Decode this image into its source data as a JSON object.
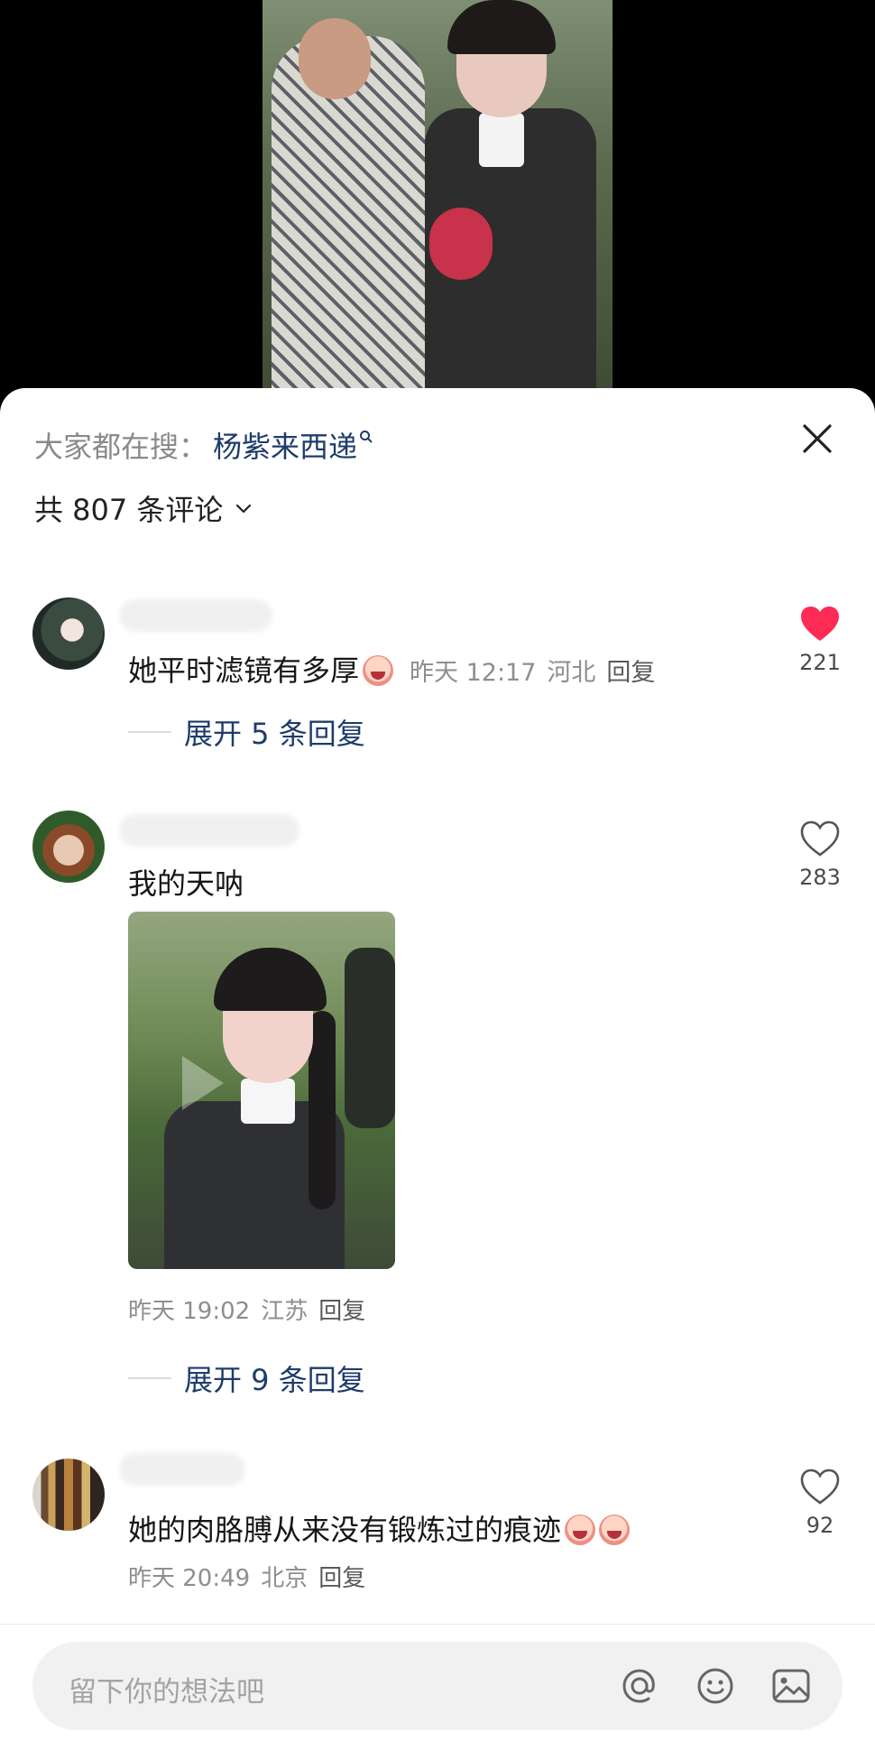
{
  "sheet": {
    "search_prefix": "大家都在搜：",
    "search_term": "杨紫来西递",
    "comment_count": "共 807 条评论"
  },
  "comments": [
    {
      "text": "她平时滤镜有多厚",
      "time": "昨天 12:17",
      "location": "河北",
      "reply_label": "回复",
      "expand_label": "展开 5 条回复",
      "likes": "221",
      "liked": true
    },
    {
      "text": "我的天呐",
      "time": "昨天 19:02",
      "location": "江苏",
      "reply_label": "回复",
      "expand_label": "展开 9 条回复",
      "likes": "283",
      "liked": false
    },
    {
      "text": "她的肉胳膊从来没有锻炼过的痕迹",
      "time": "昨天 20:49",
      "location": "北京",
      "reply_label": "回复",
      "likes": "92",
      "liked": false
    }
  ],
  "input": {
    "placeholder": "留下你的想法吧"
  },
  "colors": {
    "accent_link": "#1e3c6b",
    "like_red": "#fe2c55",
    "muted": "#8e8e8e"
  },
  "icons": [
    "search-icon",
    "close-icon",
    "chevron-down-icon",
    "heart-filled-icon",
    "heart-outline-icon",
    "at-icon",
    "emoji-icon",
    "image-icon"
  ]
}
